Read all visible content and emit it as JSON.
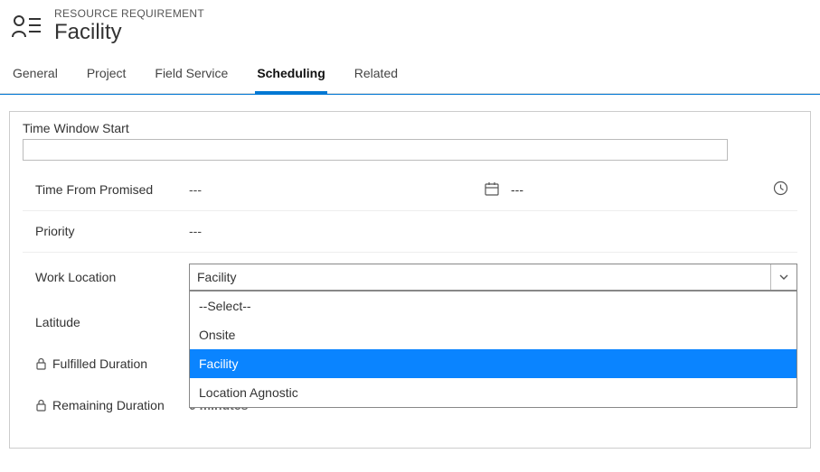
{
  "header": {
    "subtitle": "RESOURCE REQUIREMENT",
    "title": "Facility"
  },
  "tabs": {
    "general": "General",
    "project": "Project",
    "field_service": "Field Service",
    "scheduling": "Scheduling",
    "related": "Related"
  },
  "form": {
    "time_window_start": {
      "label": "Time Window Start",
      "value": ""
    },
    "time_from_promised": {
      "label": "Time From Promised",
      "value": "---",
      "date_value": "---"
    },
    "priority": {
      "label": "Priority",
      "value": "---"
    },
    "work_location": {
      "label": "Work Location",
      "value": "Facility",
      "options": {
        "select": "--Select--",
        "onsite": "Onsite",
        "facility": "Facility",
        "agnostic": "Location Agnostic"
      }
    },
    "latitude": {
      "label": "Latitude"
    },
    "fulfilled_duration": {
      "label": "Fulfilled Duration"
    },
    "remaining_duration": {
      "label": "Remaining Duration",
      "hidden_value": "0 minutes"
    }
  }
}
